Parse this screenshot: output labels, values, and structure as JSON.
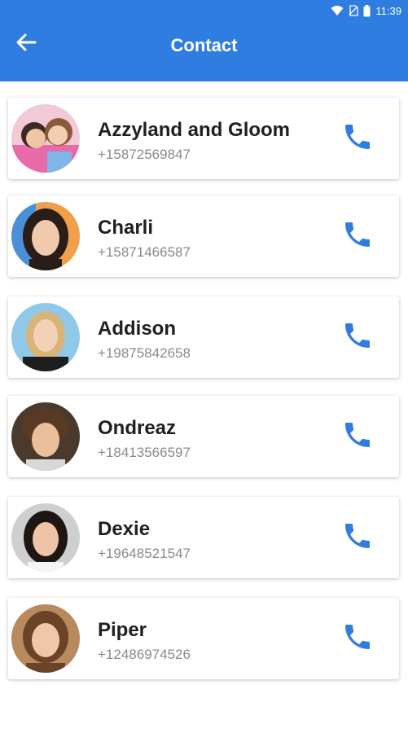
{
  "status_bar": {
    "time": "11:39"
  },
  "header": {
    "title": "Contact"
  },
  "accent_color": "#2f7de1",
  "contacts": [
    {
      "name": "Azzyland and Gloom",
      "phone": "+15872569847"
    },
    {
      "name": "Charli",
      "phone": "+15871466587"
    },
    {
      "name": "Addison",
      "phone": "+19875842658"
    },
    {
      "name": "Ondreaz",
      "phone": "+18413566597"
    },
    {
      "name": "Dexie",
      "phone": "+19648521547"
    },
    {
      "name": "Piper",
      "phone": "+12486974526"
    }
  ]
}
